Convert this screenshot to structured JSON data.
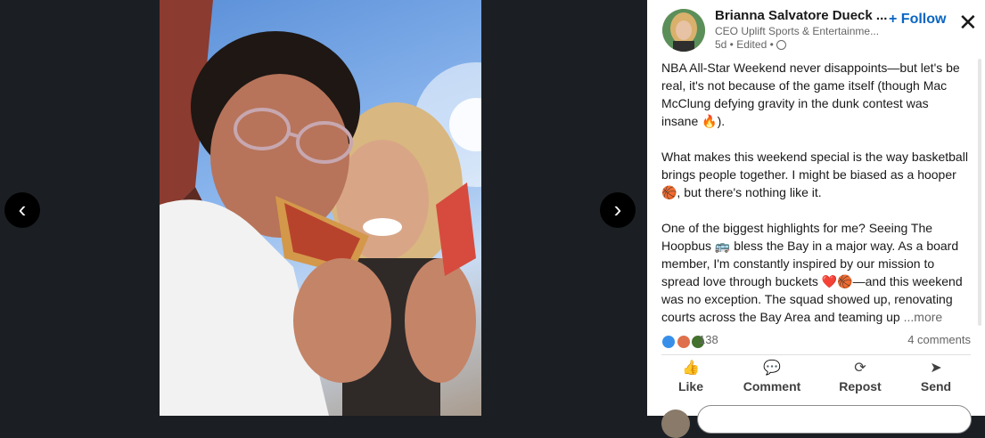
{
  "viewer": {
    "prev_label": "‹",
    "next_label": "›"
  },
  "author": {
    "name": "Brianna Salvatore Dueck ...",
    "title": "CEO Uplift Sports & Entertainme...",
    "meta": "5d • Edited •"
  },
  "follow_label": "+ Follow",
  "close_label": "✕",
  "post": {
    "p1": "NBA All-Star Weekend never disappoints—but let's be real, it's not because of the game itself (though Mac McClung defying gravity in the dunk contest was insane 🔥).",
    "p2": "What makes this weekend special is the way basketball brings people together. I might be biased as a hooper 🏀, but there's nothing like it.",
    "p3": "One of the biggest highlights for me? Seeing The Hoopbus 🚌 bless the Bay in a major way. As a board member, I'm constantly inspired by our mission to spread love through buckets ❤️🏀—and this weekend was no exception. The squad showed up, renovating courts across the Bay Area and teaming up ",
    "more": "...more"
  },
  "stats": {
    "reaction_count": "138",
    "comments": "4 comments"
  },
  "actions": [
    {
      "label": "Like",
      "icon": "thumbs-up-icon"
    },
    {
      "label": "Comment",
      "icon": "comment-icon"
    },
    {
      "label": "Repost",
      "icon": "repost-icon"
    },
    {
      "label": "Send",
      "icon": "send-icon"
    }
  ],
  "colors": {
    "accent": "#0a66c2",
    "viewer_bg": "#1b1f23"
  }
}
